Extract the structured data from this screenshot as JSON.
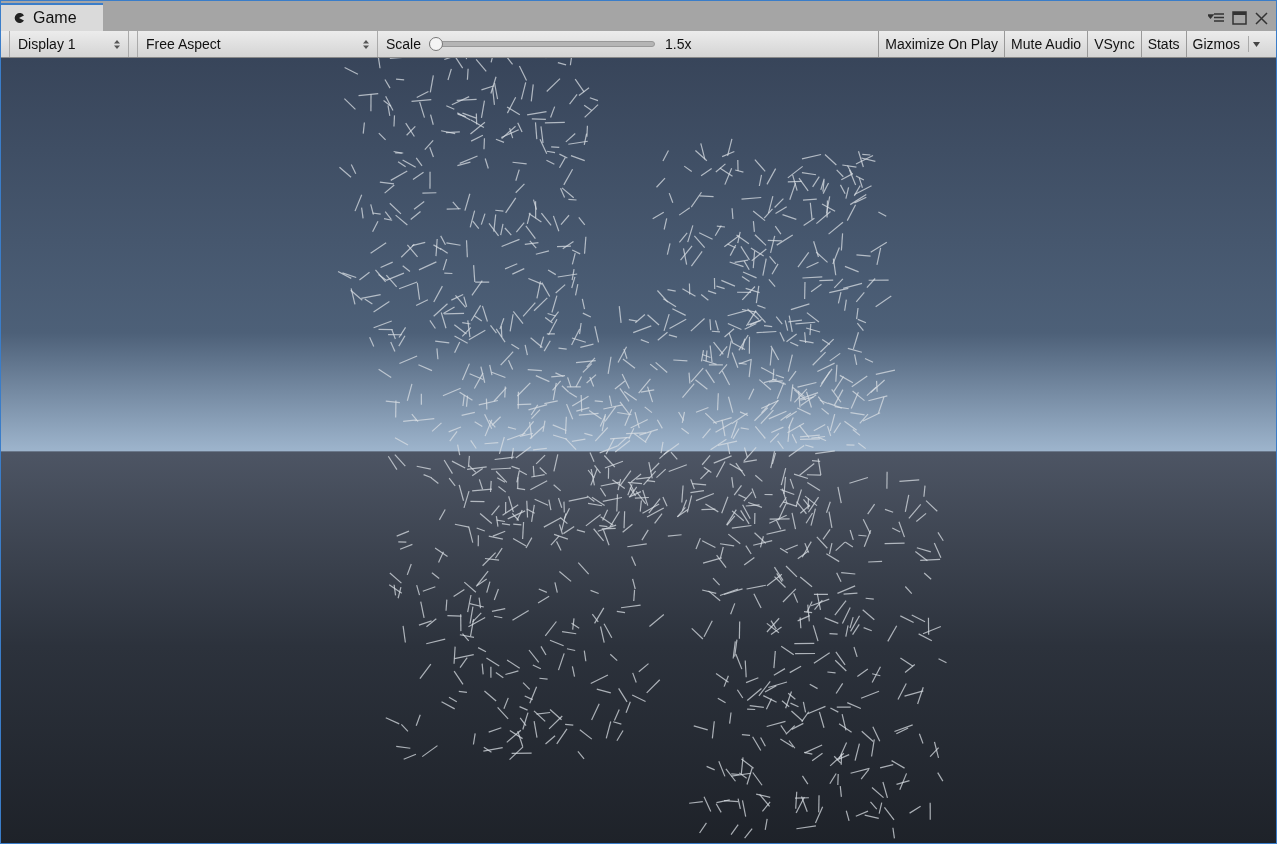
{
  "tabs": [
    {
      "label": "Game",
      "selected": true
    }
  ],
  "toolbar": {
    "display": {
      "value": "Display 1"
    },
    "aspect": {
      "value": "Free Aspect"
    },
    "scale": {
      "label": "Scale",
      "level": 0.0,
      "reading": "1.5x"
    },
    "toggles": [
      {
        "label": "Maximize On Play",
        "on": false
      },
      {
        "label": "Mute Audio",
        "on": false
      },
      {
        "label": "VSync",
        "on": false
      },
      {
        "label": "Stats",
        "on": false
      },
      {
        "label": "Gizmos",
        "on": false
      }
    ]
  }
}
